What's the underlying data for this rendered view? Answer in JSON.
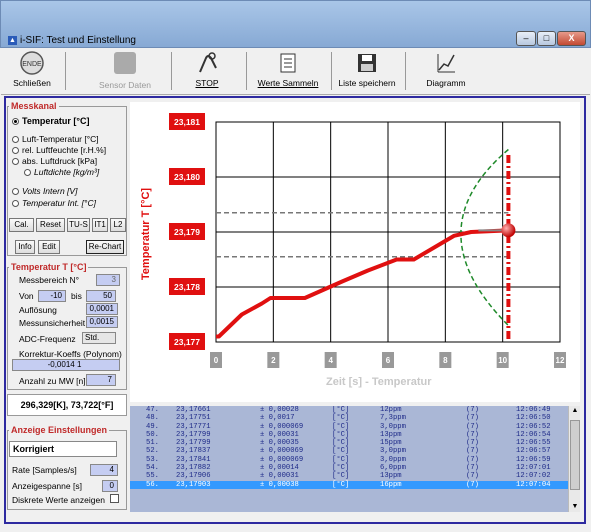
{
  "window": {
    "title": "i-SIF: Test und Einstellung",
    "minimize": "–",
    "maximize": "□",
    "close": "X"
  },
  "toolbar": {
    "close_icon_text": "ENDE",
    "close": "Schließen",
    "sensor": "Sensor Daten",
    "stop": "STOP",
    "collect": "Werte Sammeln",
    "save_list": "Liste speichern",
    "diagram": "Diagramm"
  },
  "messkanal": {
    "title": "Messkanal",
    "options": [
      "Temperatur [°C]",
      "Luft-Temperatur [°C]",
      "rel. Luftfeuchte [r.H.%]",
      "abs. Luftdruck [kPa]",
      "Luftdichte [kg/m³]",
      "Volts Intern [V]",
      "Temperatur Int. [°C]"
    ],
    "selected": 0,
    "buttons": [
      "Cal.",
      "Reset",
      "TU-S",
      "IT1",
      "L2"
    ],
    "info": "Info",
    "edit": "Edit",
    "rechart": "Re-Chart"
  },
  "temp_panel": {
    "title": "Temperatur T [°C]",
    "messbereich_label": "Messbereich N°",
    "messbereich_value": "3",
    "von_label": "Von",
    "von_value": "-10",
    "bis_label": "bis",
    "bis_value": "50",
    "aufloesung_label": "Auflösung",
    "aufloesung_value": "0,0001",
    "unsicherheit_label": "Messunsicherheit",
    "unsicherheit_value": "0,0015",
    "adc_label": "ADC-Frequenz",
    "adc_value": "Std.",
    "koeff_label": "Korrektur-Koeffs (Polynom)",
    "koeff_value": "-0,0014 1",
    "anzahl_label": "Anzahl zu MW [n]",
    "anzahl_value": "7"
  },
  "readout": "296,329[K], 73,722[°F]",
  "anzeige": {
    "title": "Anzeige Einstellungen",
    "mode": "Korrigiert",
    "rate_label": "Rate [Samples/s]",
    "rate_value": "4",
    "span_label": "Anzeigespanne [s]",
    "span_value": "0",
    "discrete_label": "Diskrete Werte anzeigen"
  },
  "chart_data": {
    "type": "line",
    "ylabel": "Temperatur T [°C]",
    "xlabel": "Zeit [s] - Temperatur",
    "x_ticks": [
      "0",
      "2",
      "4",
      "6",
      "8",
      "10",
      "12"
    ],
    "y_ticks": [
      "23,177",
      "23,178",
      "23,179",
      "23,180",
      "23,181"
    ],
    "xlim": [
      0,
      12
    ],
    "ylim": [
      23.177,
      23.181
    ],
    "series": [
      {
        "x": [
          0,
          0.1,
          0.9,
          1.6,
          1.9,
          3.1,
          4.4,
          5.3,
          6.3,
          6.9,
          8.3,
          8.9,
          10.2
        ],
        "y": [
          23.1771,
          23.1771,
          23.1775,
          23.1777,
          23.1778,
          23.1778,
          23.1781,
          23.1783,
          23.1785,
          23.1785,
          23.17893,
          23.179,
          23.17903
        ],
        "color": "#e01010"
      }
    ],
    "current": {
      "x": 10.2,
      "y": 23.17903
    },
    "mean_line_y": 23.17903,
    "band": [
      23.17855,
      23.17935
    ],
    "cursor_x": 10.2
  },
  "table": {
    "rows": [
      [
        "47.",
        "23,17661",
        "± 0,00028",
        "[°C]",
        "12ppm",
        "(7)",
        "12:06:49"
      ],
      [
        "48.",
        "23,17751",
        "± 0,0017",
        "[°C]",
        "7,3ppm",
        "(7)",
        "12:06:50"
      ],
      [
        "49.",
        "23,17771",
        "± 0,000069",
        "[°C]",
        "3,0ppm",
        "(7)",
        "12:06:52"
      ],
      [
        "50.",
        "23,17799",
        "± 0,00031",
        "[°C]",
        "13ppm",
        "(7)",
        "12:06:54"
      ],
      [
        "51.",
        "23,17799",
        "± 0,00035",
        "[°C]",
        "15ppm",
        "(7)",
        "12:06:55"
      ],
      [
        "52.",
        "23,17837",
        "± 0,000069",
        "[°C]",
        "3,0ppm",
        "(7)",
        "12:06:57"
      ],
      [
        "53.",
        "23,17841",
        "± 0,000069",
        "[°C]",
        "3,0ppm",
        "(7)",
        "12:06:59"
      ],
      [
        "54.",
        "23,17882",
        "± 0,00014",
        "[°C]",
        "6,0ppm",
        "(7)",
        "12:07:01"
      ],
      [
        "55.",
        "23,17906",
        "± 0,00031",
        "[°C]",
        "13ppm",
        "(7)",
        "12:07:02"
      ],
      [
        "56.",
        "23,17903",
        "± 0,00038",
        "[°C]",
        "16ppm",
        "(7)",
        "12:07:04"
      ]
    ],
    "selected": 9
  }
}
